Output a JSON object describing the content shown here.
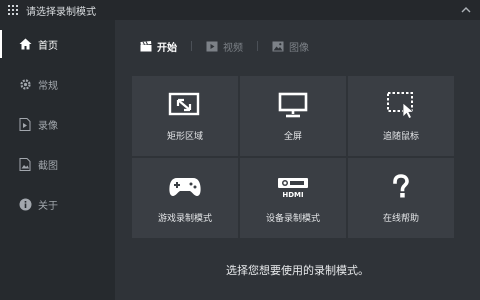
{
  "window": {
    "title": "请选择录制模式"
  },
  "sidebar": {
    "items": [
      {
        "label": "首页",
        "icon": "home-icon",
        "active": true
      },
      {
        "label": "常规",
        "icon": "gear-icon",
        "active": false
      },
      {
        "label": "录像",
        "icon": "video-file-icon",
        "active": false
      },
      {
        "label": "截图",
        "icon": "image-file-icon",
        "active": false
      },
      {
        "label": "关于",
        "icon": "info-icon",
        "active": false
      }
    ]
  },
  "tabs": [
    {
      "label": "开始",
      "icon": "clapperboard-icon",
      "active": true
    },
    {
      "label": "视频",
      "icon": "video-icon",
      "active": false
    },
    {
      "label": "图像",
      "icon": "image-icon",
      "active": false
    }
  ],
  "modes": [
    {
      "label": "矩形区域",
      "icon": "rectangle-region-icon"
    },
    {
      "label": "全屏",
      "icon": "monitor-icon"
    },
    {
      "label": "追随鼠标",
      "icon": "follow-mouse-icon"
    },
    {
      "label": "游戏录制模式",
      "icon": "gamepad-icon"
    },
    {
      "label": "设备录制模式",
      "icon": "hdmi-device-icon"
    },
    {
      "label": "在线帮助",
      "icon": "help-icon"
    }
  ],
  "device_icon_text": "HDMI",
  "hint": "选择您想要使用的录制模式。"
}
